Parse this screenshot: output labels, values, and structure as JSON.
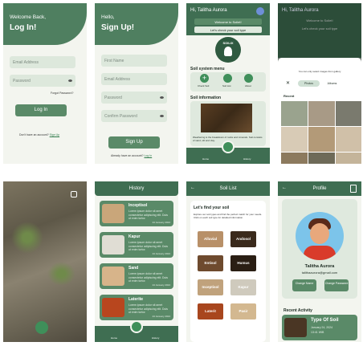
{
  "login": {
    "greeting": "Welcome Back,",
    "title": "Log In!",
    "email_placeholder": "Email Address",
    "password_placeholder": "Password",
    "forgot": "Forgot Password?",
    "button": "Log In",
    "no_account": "Don't have an account?",
    "signup_link": "Sign Up"
  },
  "signup": {
    "greeting": "Hello,",
    "title": "Sign Up!",
    "first_name": "First Name",
    "email": "Email Address",
    "password": "Password",
    "confirm": "Confirm Password",
    "button": "Sign Up",
    "have_account": "Already have an account?",
    "login_link": "Log In"
  },
  "home": {
    "greeting": "Hi, Talitha Aurora",
    "welcome": "Welcome to Soilet!",
    "check": "Let's check your soil type",
    "logo_text": "SOILIX",
    "menu_title": "Soil system menu",
    "menu_items": [
      "Check Soil",
      "Soil List",
      "About"
    ],
    "info_title": "Soil information",
    "info_text": "Weathering is the breakdown of rocks and minerals. Soil consists of sand, silt and clay.",
    "nav_home": "Home",
    "nav_history": "History"
  },
  "gallery": {
    "greeting": "Hi, Talitha Aurora",
    "welcome": "Welcome to Soilet!",
    "check": "Let's check your soil type",
    "dialog_text": "You can only select images from gallery",
    "tab_photos": "Photos",
    "tab_albums": "Albums",
    "recent": "Recent"
  },
  "camera": {},
  "history": {
    "title": "History",
    "items": [
      {
        "name": "Inceptisol",
        "desc": "Lorem ipsum dolor sit amet consectetur adipiscing elit. Duis ut enim tortor.",
        "date": "24 January 2024"
      },
      {
        "name": "Kapur",
        "desc": "Lorem ipsum dolor sit amet consectetur adipiscing elit. Duis ut enim tortor.",
        "date": "24 January 2024"
      },
      {
        "name": "Sand",
        "desc": "Lorem ipsum dolor sit amet consectetur adipiscing elit. Duis ut enim tortor.",
        "date": "24 January 2024"
      },
      {
        "name": "Laterite",
        "desc": "Lorem ipsum dolor sit amet consectetur adipiscing elit. Duis ut enim tortor.",
        "date": "24 January 2024"
      }
    ],
    "nav_home": "Home",
    "nav_history": "History"
  },
  "soillist": {
    "title": "Soil List",
    "heading": "Let's find your soil",
    "desc": "Explore our soil types and find the perfect match for your needs. Click on each soil type for detailed information.",
    "tiles": [
      "Alluvial",
      "Andosol",
      "Entisol",
      "Humus",
      "Inceptisol",
      "Kapur",
      "Laterit",
      "Pasir"
    ]
  },
  "profile": {
    "title": "Profile",
    "name": "Talitha Aurora",
    "email": "talithaaurora@gmail.com",
    "change_name": "Change Name",
    "change_password": "Change Password",
    "recent": "Recent Activity",
    "activity_title": "Type Of Soil",
    "activity_date": "January 24, 2024",
    "activity_time": "13:41 WIB"
  },
  "colors": {
    "primary": "#3f6e52",
    "accent": "#5a8a68",
    "background": "#f3f5ef"
  }
}
